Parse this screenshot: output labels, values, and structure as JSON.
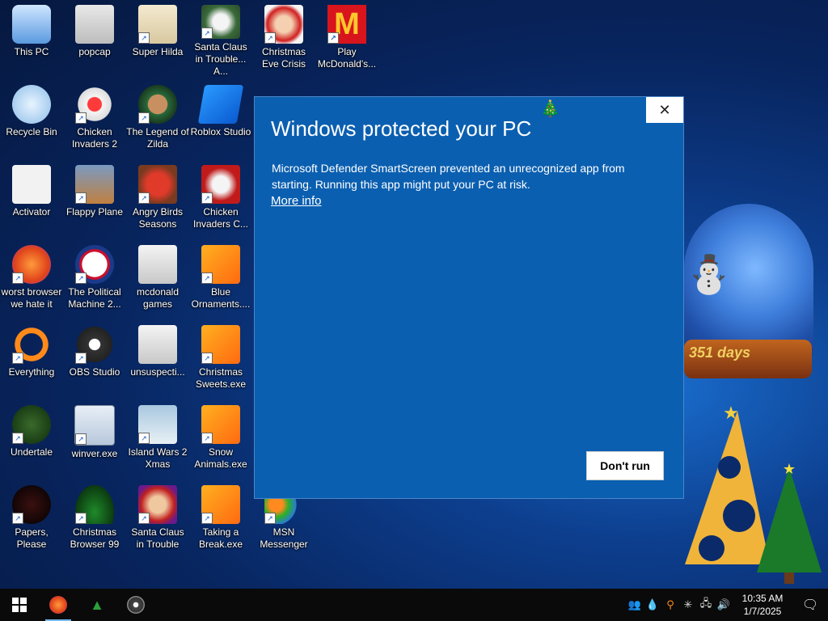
{
  "desktop": {
    "icons": [
      {
        "label": "This PC"
      },
      {
        "label": "popcap"
      },
      {
        "label": "Super Hilda"
      },
      {
        "label": "Santa Claus in Trouble... A..."
      },
      {
        "label": "Christmas Eve Crisis"
      },
      {
        "label": "Play McDonald's..."
      },
      {
        "label": "Recycle Bin"
      },
      {
        "label": "Chicken Invaders 2"
      },
      {
        "label": "The Legend of Zilda"
      },
      {
        "label": "Roblox Studio"
      },
      {
        "label": "Activator"
      },
      {
        "label": "Flappy Plane"
      },
      {
        "label": "Angry Birds Seasons"
      },
      {
        "label": "Chicken Invaders C..."
      },
      {
        "label": "worst browser we hate it"
      },
      {
        "label": "The Political Machine 2..."
      },
      {
        "label": "mcdonald games"
      },
      {
        "label": "Blue Ornaments...."
      },
      {
        "label": "Everything"
      },
      {
        "label": "OBS Studio"
      },
      {
        "label": "unsuspecti..."
      },
      {
        "label": "Christmas Sweets.exe"
      },
      {
        "label": "Undertale"
      },
      {
        "label": "winver.exe"
      },
      {
        "label": "Island Wars 2 Xmas"
      },
      {
        "label": "Snow Animals.exe"
      },
      {
        "label": "Papers, Please"
      },
      {
        "label": "Christmas Browser 99"
      },
      {
        "label": "Santa Claus in Trouble"
      },
      {
        "label": "Taking a Break.exe"
      },
      {
        "label": "MSN Messenger"
      }
    ],
    "countdown": "351 days"
  },
  "dialog": {
    "title": "Windows protected your PC",
    "message": "Microsoft Defender SmartScreen prevented an unrecognized app from starting. Running this app might put your PC at risk.",
    "more_info": "More info",
    "dont_run": "Don't run",
    "close_glyph": "✕"
  },
  "taskbar": {
    "clock_time": "10:35 AM",
    "clock_date": "1/7/2025"
  },
  "colors": {
    "dialog_bg": "#0b5fb0",
    "taskbar_bg": "#0a0a0a"
  }
}
